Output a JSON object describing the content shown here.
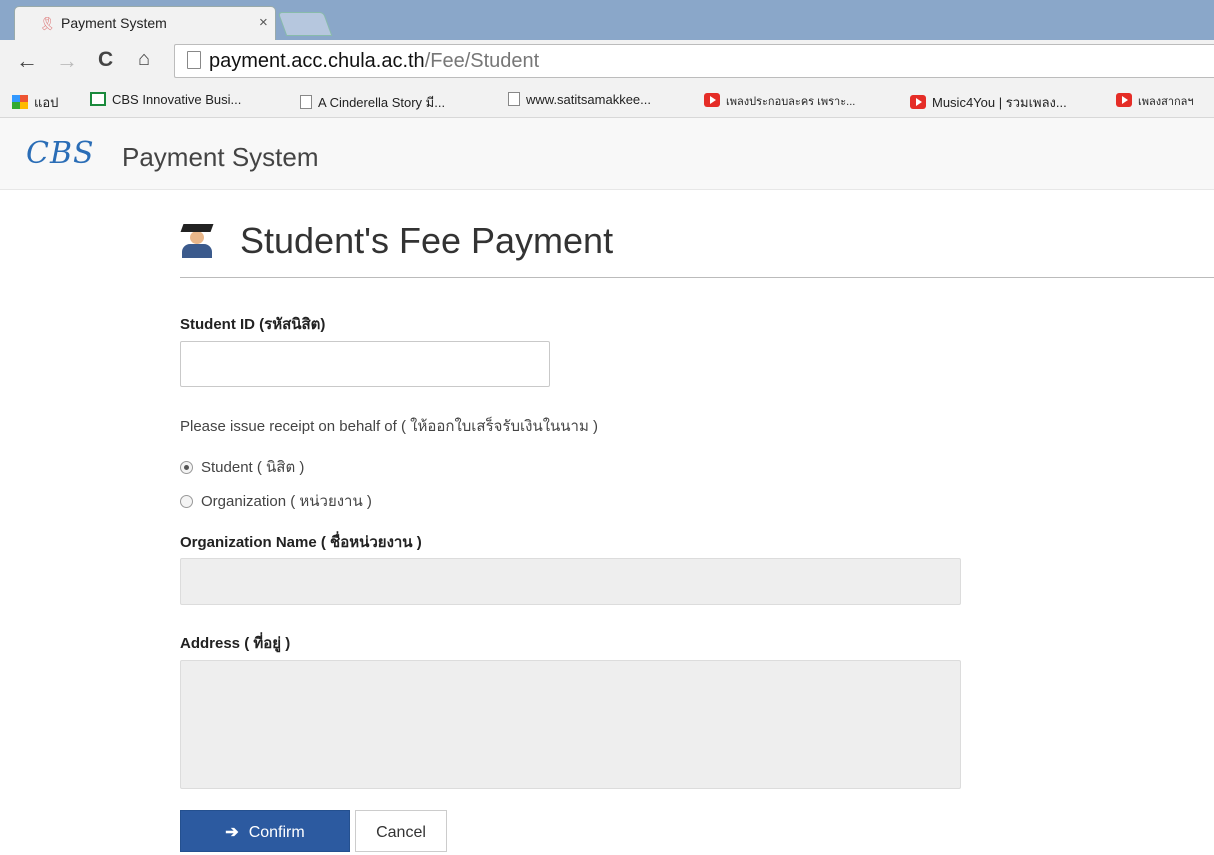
{
  "browser": {
    "tab_title": "Payment System",
    "tab_close": "×",
    "url_host": "payment.acc.chula.ac.th",
    "url_path": "/Fee/Student",
    "bookmarks": [
      {
        "label": "แอป",
        "icon": "apps-icon"
      },
      {
        "label": "CBS Innovative Busi...",
        "icon": "sheets-icon"
      },
      {
        "label": "A Cinderella Story มี...",
        "icon": "page-icon"
      },
      {
        "label": "www.satitsamakkee...",
        "icon": "page-icon"
      },
      {
        "label": "เพลงประกอบละคร เพราะ...",
        "icon": "youtube-icon"
      },
      {
        "label": "Music4You | รวมเพลง...",
        "icon": "youtube-icon"
      },
      {
        "label": "เพลงสากลฯ",
        "icon": "youtube-icon"
      }
    ]
  },
  "app": {
    "logo": "CBS",
    "name": "Payment System"
  },
  "form": {
    "title": "Student's Fee Payment",
    "student_id_label": "Student ID (รหัสนิสิต)",
    "student_id_value": "",
    "receipt_prompt": "Please issue receipt on behalf of ( ให้ออกใบเสร็จรับเงินในนาม )",
    "options": [
      {
        "label": "Student ( นิสิต )",
        "checked": true
      },
      {
        "label": "Organization ( หน่วยงาน )",
        "checked": false
      }
    ],
    "org_name_label": "Organization Name ( ชื่อหน่วยงาน )",
    "org_name_value": "",
    "address_label": "Address ( ที่อยู่ )",
    "address_value": "",
    "confirm_label": "Confirm",
    "cancel_label": "Cancel"
  },
  "colors": {
    "primary": "#2c5aa0",
    "logo": "#2a6db6"
  }
}
